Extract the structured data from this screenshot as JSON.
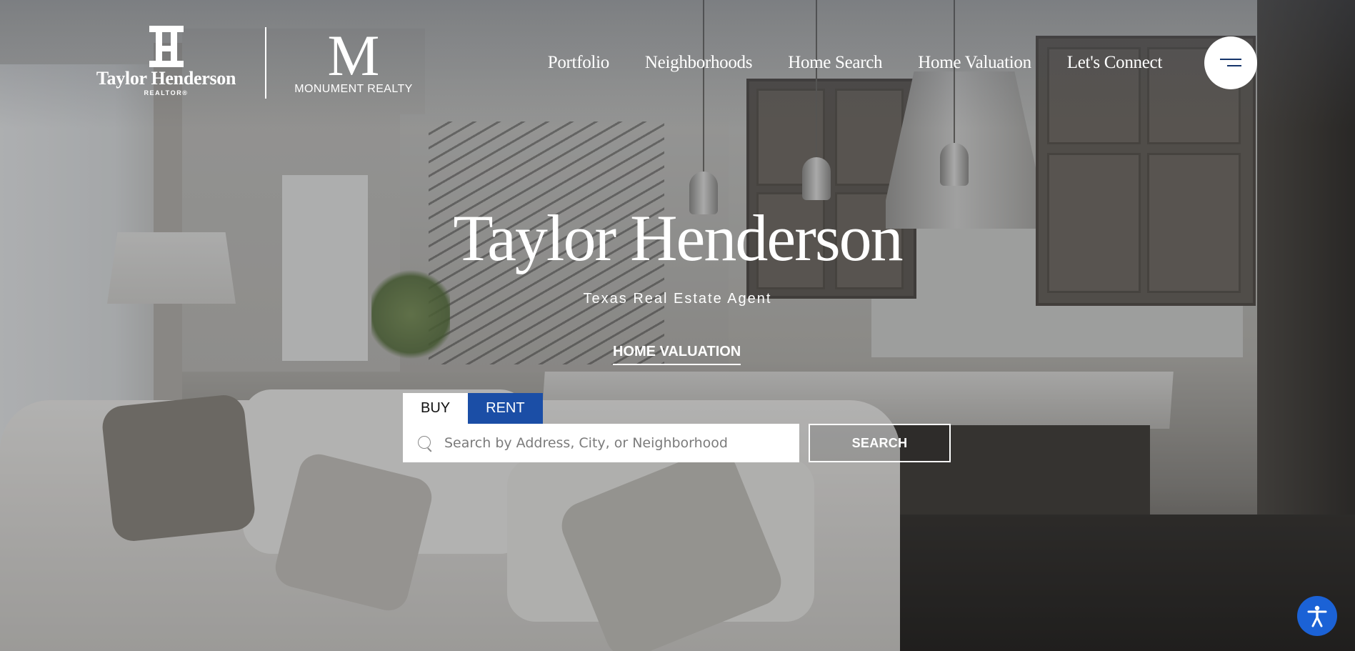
{
  "brand": {
    "agent_logo_name": "Taylor Henderson",
    "agent_logo_sub": "REALTOR®",
    "brokerage_logo_letter": "M",
    "brokerage_logo_name": "MONUMENT REALTY"
  },
  "nav": {
    "items": [
      "Portfolio",
      "Neighborhoods",
      "Home Search",
      "Home Valuation",
      "Let's Connect"
    ],
    "menu_icon": "hamburger-menu-icon"
  },
  "hero": {
    "title": "Taylor Henderson",
    "subtitle": "Texas Real Estate Agent",
    "cta_link": "HOME VALUATION"
  },
  "search": {
    "tabs": [
      {
        "label": "BUY",
        "active": false
      },
      {
        "label": "RENT",
        "active": true
      }
    ],
    "placeholder": "Search by Address, City, or Neighborhood",
    "value": "",
    "button_label": "SEARCH",
    "icon": "search-icon"
  },
  "accessibility": {
    "icon": "accessibility-icon"
  },
  "colors": {
    "accent_blue": "#1b4ea6",
    "accessibility_blue": "#1b62d6",
    "menu_line": "#15346a",
    "text_light": "#ffffff"
  }
}
